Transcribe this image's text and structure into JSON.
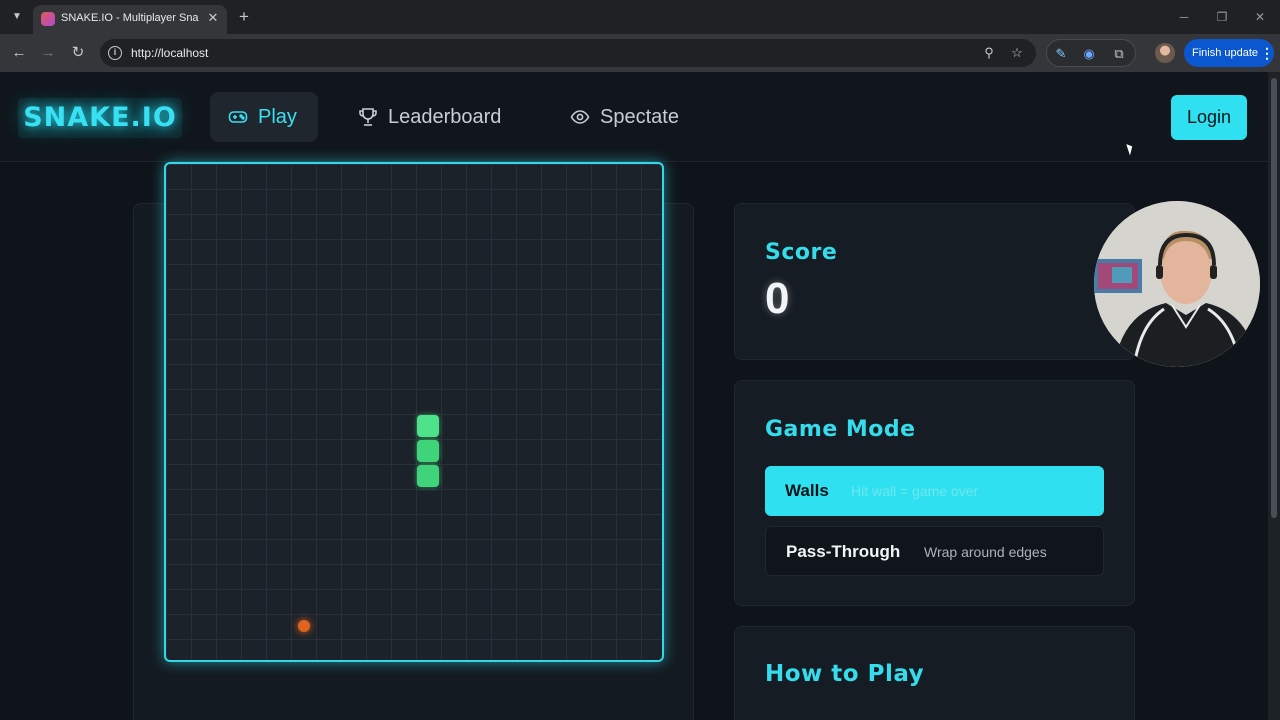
{
  "browser": {
    "tab_title": "SNAKE.IO - Multiplayer Snake G",
    "tab_close": "✕",
    "new_tab": "+",
    "url": "http://localhost",
    "finish_update": "Finish update",
    "icons": [
      "tab-search-icon",
      "favicon",
      "back-icon",
      "forward-icon",
      "reload-icon",
      "site-info-icon",
      "zoom-icon",
      "bookmark-star-icon",
      "pen-extension-icon",
      "sound-extension-icon",
      "extensions-puzzle-icon",
      "profile-avatar",
      "more-menu-icon",
      "minimize-icon",
      "restore-icon",
      "close-window-icon"
    ]
  },
  "nav": {
    "logo": "SNAKE.IO",
    "items": [
      {
        "label": "Play",
        "icon": "gamepad-icon",
        "active": true
      },
      {
        "label": "Leaderboard",
        "icon": "trophy-icon",
        "active": false
      },
      {
        "label": "Spectate",
        "icon": "eye-icon",
        "active": false
      }
    ],
    "login_label": "Login"
  },
  "score": {
    "title": "Score",
    "value": "0"
  },
  "game_mode": {
    "title": "Game Mode",
    "modes": [
      {
        "name": "Walls",
        "description": "Hit wall = game over",
        "selected": true
      },
      {
        "name": "Pass-Through",
        "description": "Wrap around edges",
        "selected": false
      }
    ]
  },
  "how_to_play": {
    "title": "How to Play"
  },
  "colors": {
    "accent": "#2fe1f0",
    "snake": "#3fd47a",
    "food": "#e0641f",
    "background": "#0f141a"
  }
}
